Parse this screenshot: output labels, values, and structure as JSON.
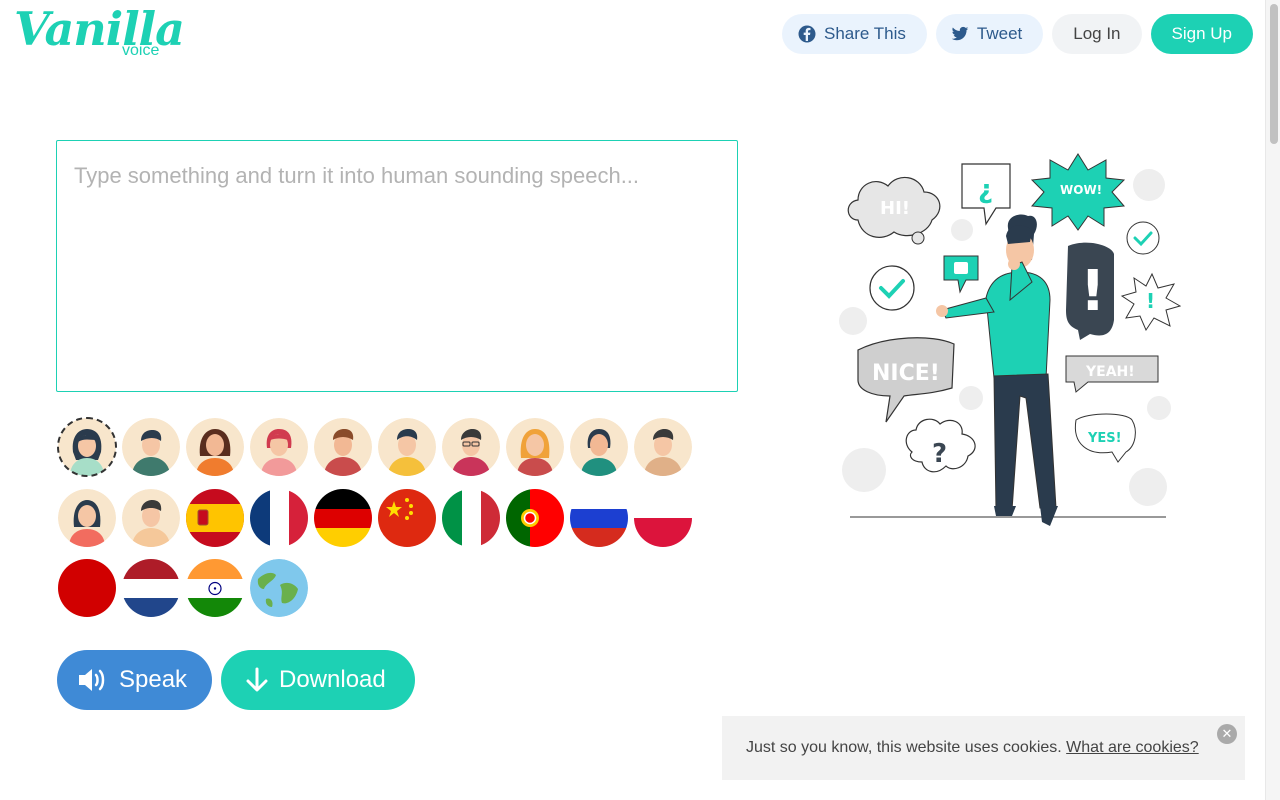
{
  "brand": {
    "name": "Vanilla",
    "sub": "voice",
    "color": "#1dd1b4"
  },
  "nav": {
    "share_label": "Share This",
    "tweet_label": "Tweet",
    "login_label": "Log In",
    "signup_label": "Sign Up"
  },
  "editor": {
    "placeholder": "Type something and turn it into human sounding speech...",
    "value": ""
  },
  "voices": {
    "avatars": [
      "avatar-woman-1",
      "avatar-man-1",
      "avatar-woman-2",
      "avatar-woman-3",
      "avatar-man-2",
      "avatar-man-3",
      "avatar-man-4",
      "avatar-woman-4",
      "avatar-woman-5",
      "avatar-man-5",
      "avatar-woman-6",
      "avatar-man-6"
    ],
    "flags": [
      "flag-spain",
      "flag-france",
      "flag-germany",
      "flag-china",
      "flag-italy",
      "flag-portugal",
      "flag-russia",
      "flag-poland",
      "flag-japan",
      "flag-netherlands",
      "flag-india",
      "globe-icon"
    ],
    "selected": "avatar-woman-1"
  },
  "actions": {
    "speak_label": "Speak",
    "download_label": "Download"
  },
  "illustration": {
    "bubbles": [
      "HI!",
      "¿",
      "WOW!",
      "NICE!",
      "YEAH!",
      "YES!",
      "?",
      "!"
    ]
  },
  "cookie": {
    "text": "Just so you know, this website uses cookies.",
    "link": "What are cookies?",
    "close": "✕"
  },
  "colors": {
    "accent": "#1dd1b4",
    "speak": "#3f8ad6"
  }
}
